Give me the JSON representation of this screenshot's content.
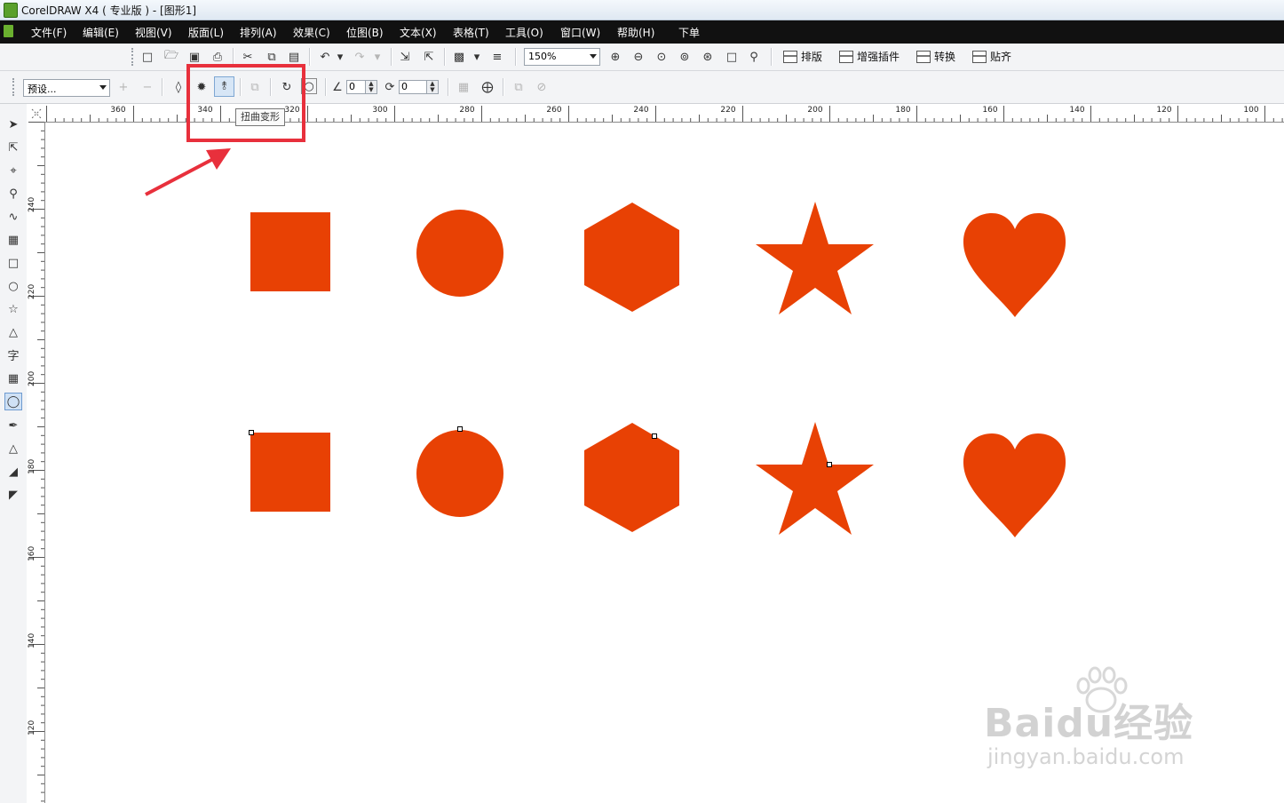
{
  "window": {
    "title": "CorelDRAW X4 ( 专业版 ) - [图形1]"
  },
  "menu": [
    "文件(F)",
    "编辑(E)",
    "视图(V)",
    "版面(L)",
    "排列(A)",
    "效果(C)",
    "位图(B)",
    "文本(X)",
    "表格(T)",
    "工具(O)",
    "窗口(W)",
    "帮助(H)",
    "下单"
  ],
  "toolbar": {
    "zoom": "150%",
    "plugins": [
      "排版",
      "增强插件",
      "转换",
      "贴齐"
    ]
  },
  "property_bar": {
    "preset": "预设...",
    "angle_value": "0",
    "rotation_value": "0",
    "tooltip": "扭曲变形"
  },
  "ruler": {
    "horizontal": [
      "360",
      "340",
      "320",
      "300",
      "280",
      "260",
      "240",
      "220",
      "200",
      "180",
      "160",
      "140",
      "120",
      "100"
    ],
    "vertical": [
      "240",
      "220",
      "200",
      "180",
      "160",
      "140",
      "120"
    ]
  },
  "canvas": {
    "fill_color": "#e84104",
    "rows": [
      [
        "square",
        "circle",
        "hexagon",
        "star",
        "heart"
      ],
      [
        "square",
        "circle",
        "hexagon",
        "star",
        "heart"
      ]
    ]
  },
  "annotation": {
    "color": "#e8303c"
  },
  "watermark": {
    "brand": "Baidu经验",
    "url": "jingyan.baidu.com"
  }
}
